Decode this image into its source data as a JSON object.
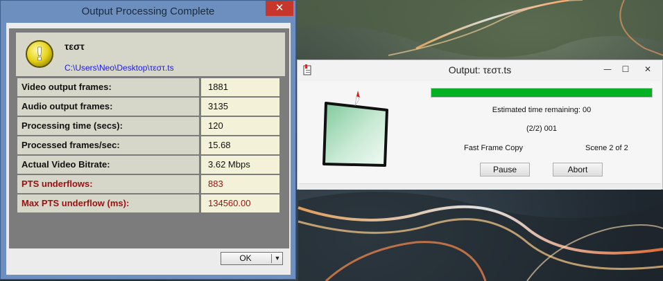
{
  "dialog": {
    "title": "Output Processing Complete",
    "close_glyph": "✕",
    "file_name": "τεστ",
    "file_path": "C:\\Users\\Neo\\Desktop\\τεστ.ts",
    "warning_icon_glyph": "!",
    "stats": [
      {
        "label": "Video output frames:",
        "value": "1881",
        "warn": false
      },
      {
        "label": "Audio output frames:",
        "value": "3135",
        "warn": false
      },
      {
        "label": "Processing time (secs):",
        "value": "120",
        "warn": false
      },
      {
        "label": "Processed frames/sec:",
        "value": "15.68",
        "warn": false
      },
      {
        "label": "Actual Video Bitrate:",
        "value": "3.62 Mbps",
        "warn": false
      },
      {
        "label": "PTS underflows:",
        "value": "883",
        "warn": true
      },
      {
        "label": "Max PTS underflow (ms):",
        "value": "134560.00",
        "warn": true
      }
    ],
    "ok_label": "OK",
    "ok_arrow": "▼"
  },
  "output_window": {
    "title": "Output: τεστ.ts",
    "minimize_glyph": "—",
    "maximize_glyph": "☐",
    "close_glyph": "✕",
    "progress_percent": 100,
    "progress_color": "#06b025",
    "estimated_time": "Estimated time remaining: 00",
    "counter": "(2/2) 001",
    "mode": "Fast Frame Copy",
    "scene": "Scene 2 of 2",
    "pause_label": "Pause",
    "abort_label": "Abort"
  }
}
